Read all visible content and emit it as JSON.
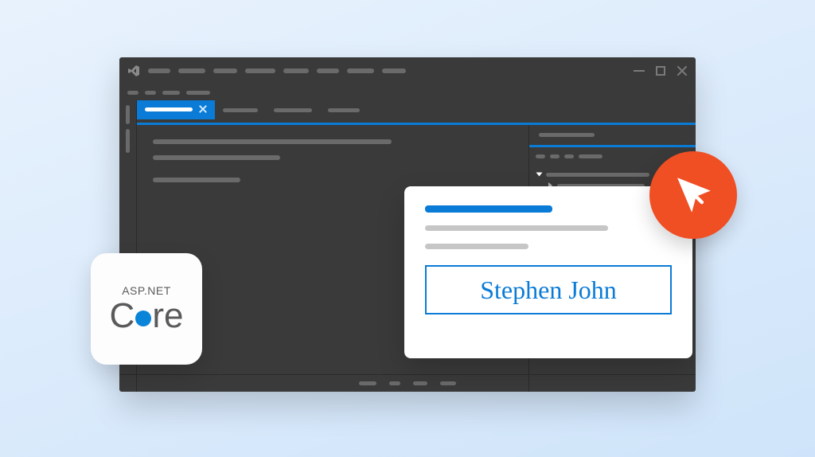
{
  "badge": {
    "top": "ASP.NET",
    "c": "C",
    "re": "re"
  },
  "card": {
    "signature": "Stephen John"
  },
  "colors": {
    "accent": "#0a7bd6",
    "orange": "#f04e23",
    "ide_bg": "#3a3a3a"
  }
}
